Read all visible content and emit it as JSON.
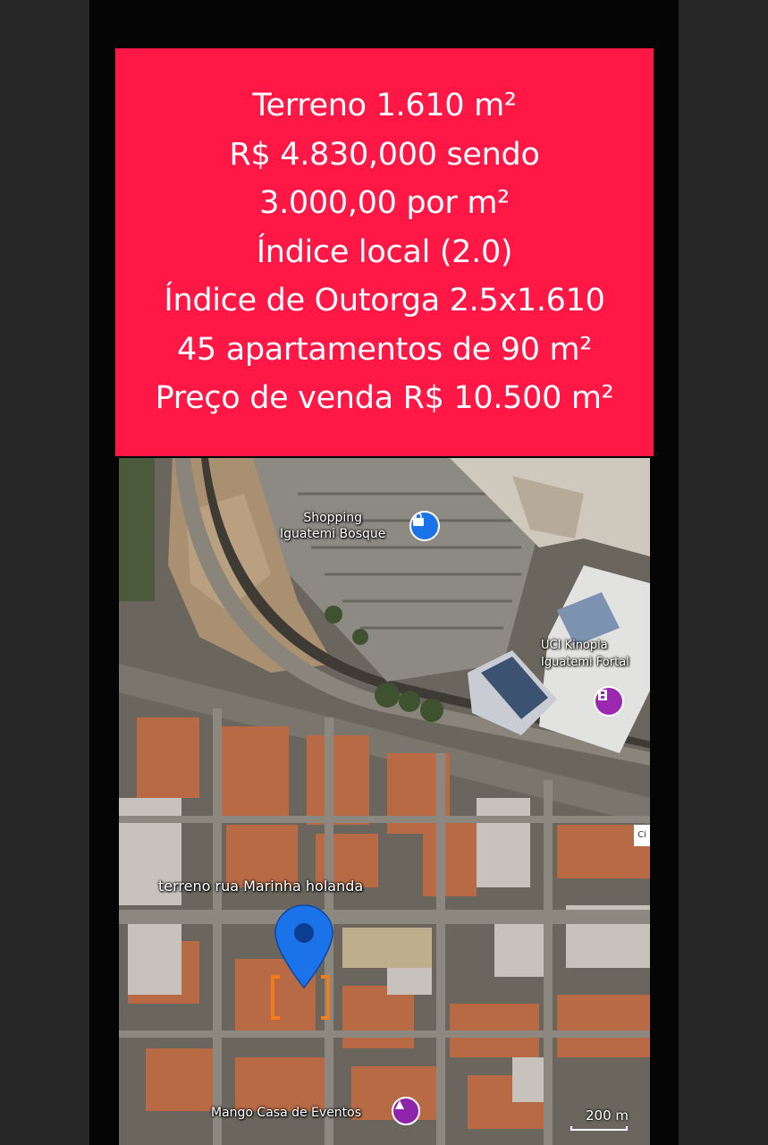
{
  "info": {
    "lines": [
      "Terreno 1.610 m²",
      "R$ 4.830,000 sendo",
      "3.000,00 por m²",
      "Índice local (2.0)",
      "Índice de Outorga 2.5x1.610",
      "45 apartamentos de 90 m²",
      "Preço de venda R$ 10.500 m²"
    ],
    "background": "#ff1745",
    "text_color": "#ffffff"
  },
  "map": {
    "poi_shopping": {
      "label_line1": "Shopping",
      "label_line2": "Iguatemi Bosque",
      "icon": "shopping-bag-icon"
    },
    "poi_cinema": {
      "label_line1": "UCI Kinopla",
      "label_line2": "Iguatemi Fortal",
      "icon": "film-icon"
    },
    "pin": {
      "label": "terreno rua Marinha holanda",
      "color": "#1a73e8",
      "icon": "location-pin-icon"
    },
    "poi_event": {
      "label": "Mango Casa de Eventos",
      "icon": "event-icon"
    },
    "scale": "200 m",
    "edge_marker": "Ci"
  }
}
